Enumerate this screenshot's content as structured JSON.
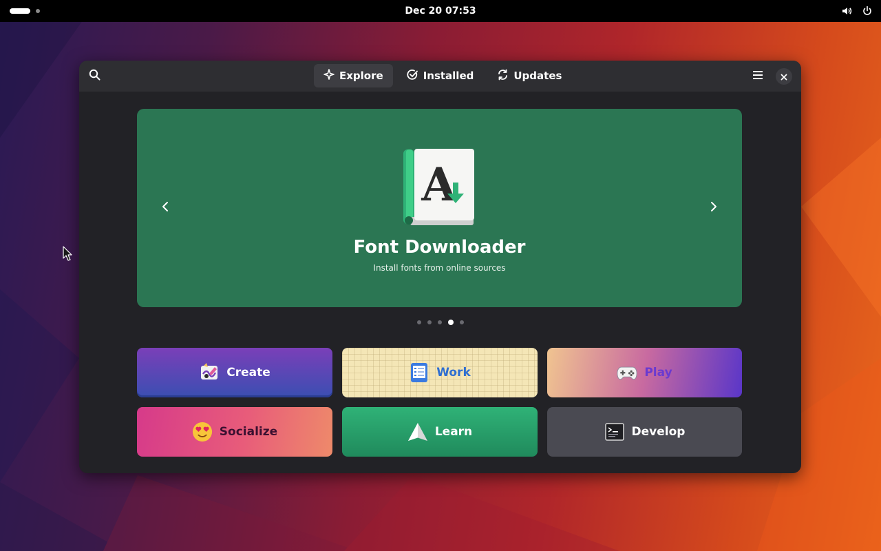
{
  "topbar": {
    "clock": "Dec 20  07:53",
    "icons": [
      "activities-pill",
      "volume-icon",
      "power-icon"
    ]
  },
  "window": {
    "header": {
      "search_icon": "search-icon",
      "tabs": [
        {
          "label": "Explore",
          "icon": "sparkle-icon",
          "active": true
        },
        {
          "label": "Installed",
          "icon": "check-circle-icon",
          "active": false
        },
        {
          "label": "Updates",
          "icon": "refresh-icon",
          "active": false
        }
      ],
      "menu_icon": "hamburger-icon",
      "close_icon": "close-icon"
    },
    "banner": {
      "title": "Font Downloader",
      "subtitle": "Install fonts from online sources",
      "icon": "font-downloader-app-icon",
      "color": "#2b7653",
      "pages": 5,
      "current_page": 4
    },
    "categories": [
      {
        "label": "Create",
        "icon": "create-icon"
      },
      {
        "label": "Work",
        "icon": "work-icon"
      },
      {
        "label": "Play",
        "icon": "gamepad-icon"
      },
      {
        "label": "Socialize",
        "icon": "heart-eyes-emoji-icon"
      },
      {
        "label": "Learn",
        "icon": "paper-plane-icon"
      },
      {
        "label": "Develop",
        "icon": "terminal-icon"
      }
    ]
  }
}
